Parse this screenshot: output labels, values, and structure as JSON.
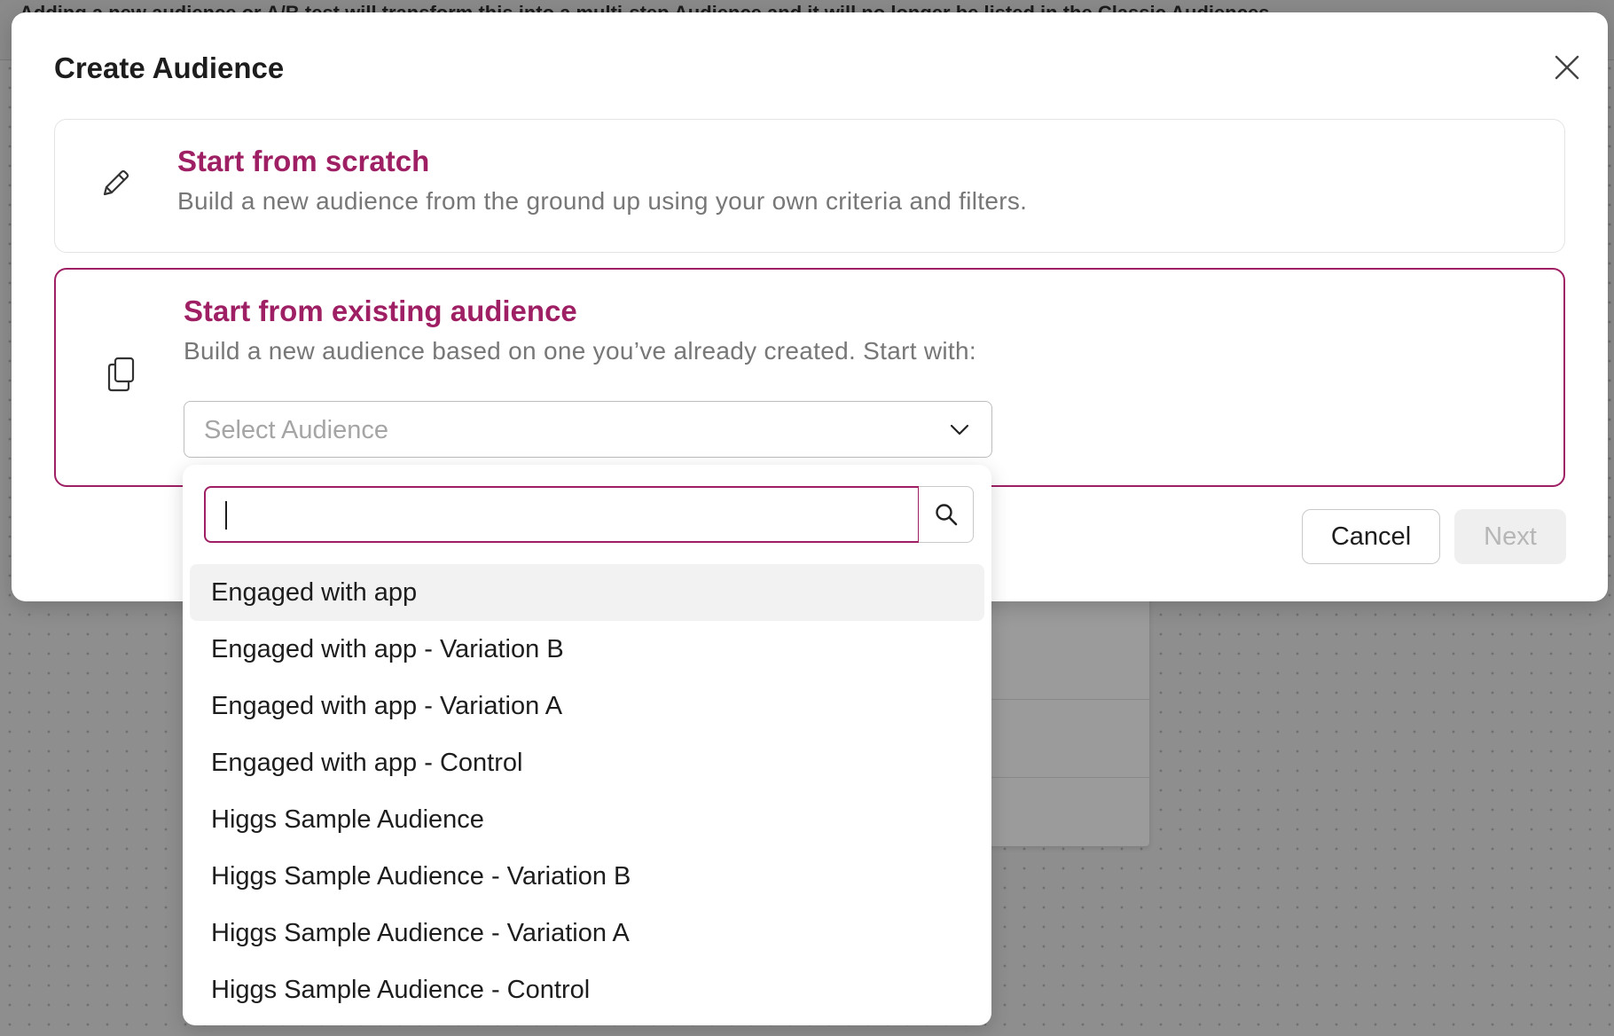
{
  "background": {
    "banner_text": "Adding a new audience or A/B test will transform this into a multi-step Audience and it will no longer be listed in the Classic Audiences"
  },
  "modal": {
    "title": "Create Audience",
    "close_icon": "close-icon",
    "options": [
      {
        "icon": "pencil-icon",
        "title": "Start from scratch",
        "description": "Build a new audience from the ground up using your own criteria and filters.",
        "selected": false
      },
      {
        "icon": "copy-icon",
        "title": "Start from existing audience",
        "description": "Build a new audience based on one you’ve already created. Start with:",
        "selected": true
      }
    ],
    "select": {
      "placeholder": "Select Audience",
      "icon": "chevron-down-icon"
    },
    "buttons": {
      "cancel": "Cancel",
      "next": "Next",
      "next_disabled": true
    }
  },
  "dropdown": {
    "search_value": "",
    "search_icon": "search-icon",
    "items": [
      "Engaged with app",
      "Engaged with app - Variation B",
      "Engaged with app - Variation A",
      "Engaged with app - Control",
      "Higgs Sample Audience",
      "Higgs Sample Audience - Variation B",
      "Higgs Sample Audience - Variation A",
      "Higgs Sample Audience - Control"
    ],
    "highlighted_index": 0
  },
  "colors": {
    "accent": "#9e1f63",
    "overlay": "#8e8e8e",
    "muted_text": "#777777",
    "disabled_text": "#b6b6b6"
  }
}
